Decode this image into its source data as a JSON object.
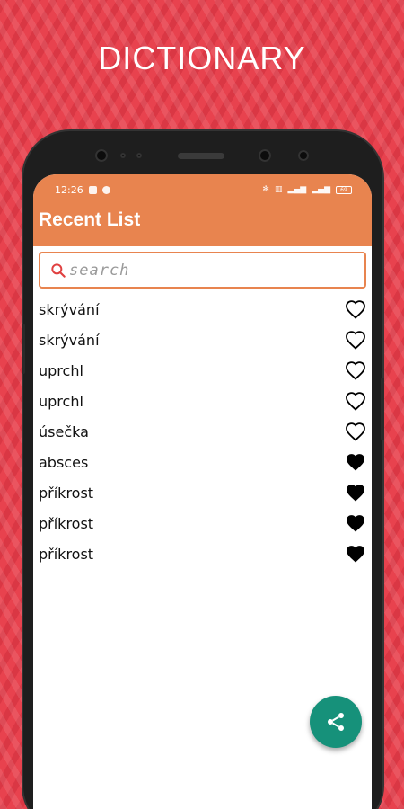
{
  "promo": {
    "title": "DICTIONARY"
  },
  "status_bar": {
    "time": "12:26",
    "battery": "69"
  },
  "header": {
    "title": "Recent List"
  },
  "search": {
    "placeholder": "search",
    "value": ""
  },
  "words": [
    {
      "text": "skrývání",
      "favorite": false
    },
    {
      "text": "skrývání",
      "favorite": false
    },
    {
      "text": "uprchl",
      "favorite": false
    },
    {
      "text": "uprchl",
      "favorite": false
    },
    {
      "text": "úsečka",
      "favorite": false
    },
    {
      "text": "absces",
      "favorite": true
    },
    {
      "text": "příkrost",
      "favorite": true
    },
    {
      "text": "příkrost",
      "favorite": true
    },
    {
      "text": "příkrost",
      "favorite": true
    }
  ],
  "icons": {
    "search": "search-icon",
    "favorite_on": "heart-filled-icon",
    "favorite_off": "heart-outline-icon",
    "share": "share-icon"
  },
  "colors": {
    "background": "#e8424e",
    "header": "#e8844f",
    "fab": "#16917a"
  }
}
